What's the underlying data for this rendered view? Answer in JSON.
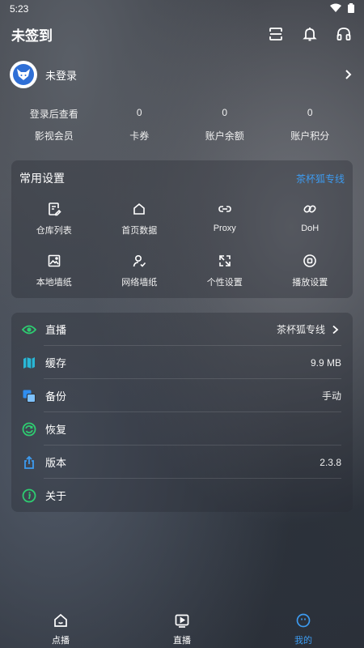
{
  "status_bar": {
    "time": "5:23"
  },
  "header": {
    "title": "未签到"
  },
  "profile": {
    "name": "未登录"
  },
  "stats": [
    {
      "value": "登录后查看",
      "label": "影视会员"
    },
    {
      "value": "0",
      "label": "卡券"
    },
    {
      "value": "0",
      "label": "账户余额"
    },
    {
      "value": "0",
      "label": "账户积分"
    }
  ],
  "settings": {
    "title": "常用设置",
    "link": "茶杯狐专线",
    "items": [
      {
        "label": "仓库列表",
        "icon": "edit-doc-icon"
      },
      {
        "label": "首页数据",
        "icon": "home-icon"
      },
      {
        "label": "Proxy",
        "icon": "link-icon"
      },
      {
        "label": "DoH",
        "icon": "chain-icon"
      },
      {
        "label": "本地墙纸",
        "icon": "image-icon"
      },
      {
        "label": "网络墙纸",
        "icon": "user-check-icon"
      },
      {
        "label": "个性设置",
        "icon": "expand-icon"
      },
      {
        "label": "播放设置",
        "icon": "play-circle-icon"
      }
    ]
  },
  "list": [
    {
      "label": "直播",
      "value": "茶杯狐专线",
      "icon": "eye-icon",
      "color": "#2ecc71",
      "chevron": true
    },
    {
      "label": "缓存",
      "value": "9.9 MB",
      "icon": "map-icon",
      "color": "#2ab7d6"
    },
    {
      "label": "备份",
      "value": "手动",
      "icon": "copy-icon",
      "color": "#2f8ef0"
    },
    {
      "label": "恢复",
      "value": "",
      "icon": "refresh-icon",
      "color": "#2ecc71"
    },
    {
      "label": "版本",
      "value": "2.3.8",
      "icon": "share-icon",
      "color": "#3d9bf0"
    },
    {
      "label": "关于",
      "value": "",
      "icon": "info-icon",
      "color": "#2ecc71"
    }
  ],
  "nav": [
    {
      "label": "点播",
      "icon": "home-tv-icon"
    },
    {
      "label": "直播",
      "icon": "play-box-icon"
    },
    {
      "label": "我的",
      "icon": "smile-icon",
      "active": true
    }
  ],
  "colors": {
    "accent": "#3d9bf0",
    "green": "#2ecc71"
  }
}
